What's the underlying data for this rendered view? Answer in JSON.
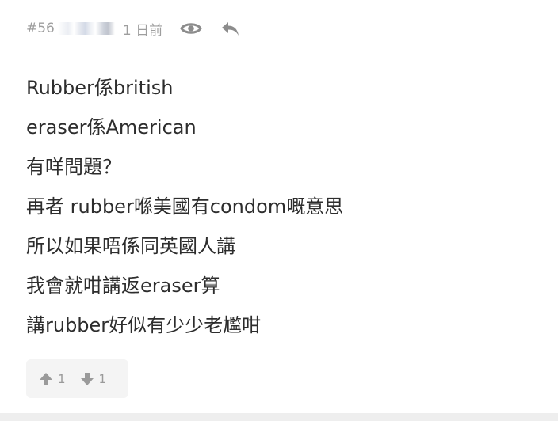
{
  "post": {
    "number": "#56",
    "time": "1 日前",
    "lines": [
      "Rubber係british",
      "eraser係American",
      "有咩問題？",
      "再者 rubber喺美國有condom嘅意思",
      "所以如果唔係同英國人講",
      "我會就咁講返eraser算",
      "講rubber好似有少少老尷咁"
    ],
    "votes": {
      "up": "1",
      "down": "1"
    }
  },
  "colors": {
    "meta_text": "#9e9e9e",
    "body_text": "#2d2d2d",
    "vote_bg": "#f4f4f4"
  },
  "icons": [
    "eye-icon",
    "reply-icon",
    "thumbs-up-icon",
    "thumbs-down-icon"
  ]
}
